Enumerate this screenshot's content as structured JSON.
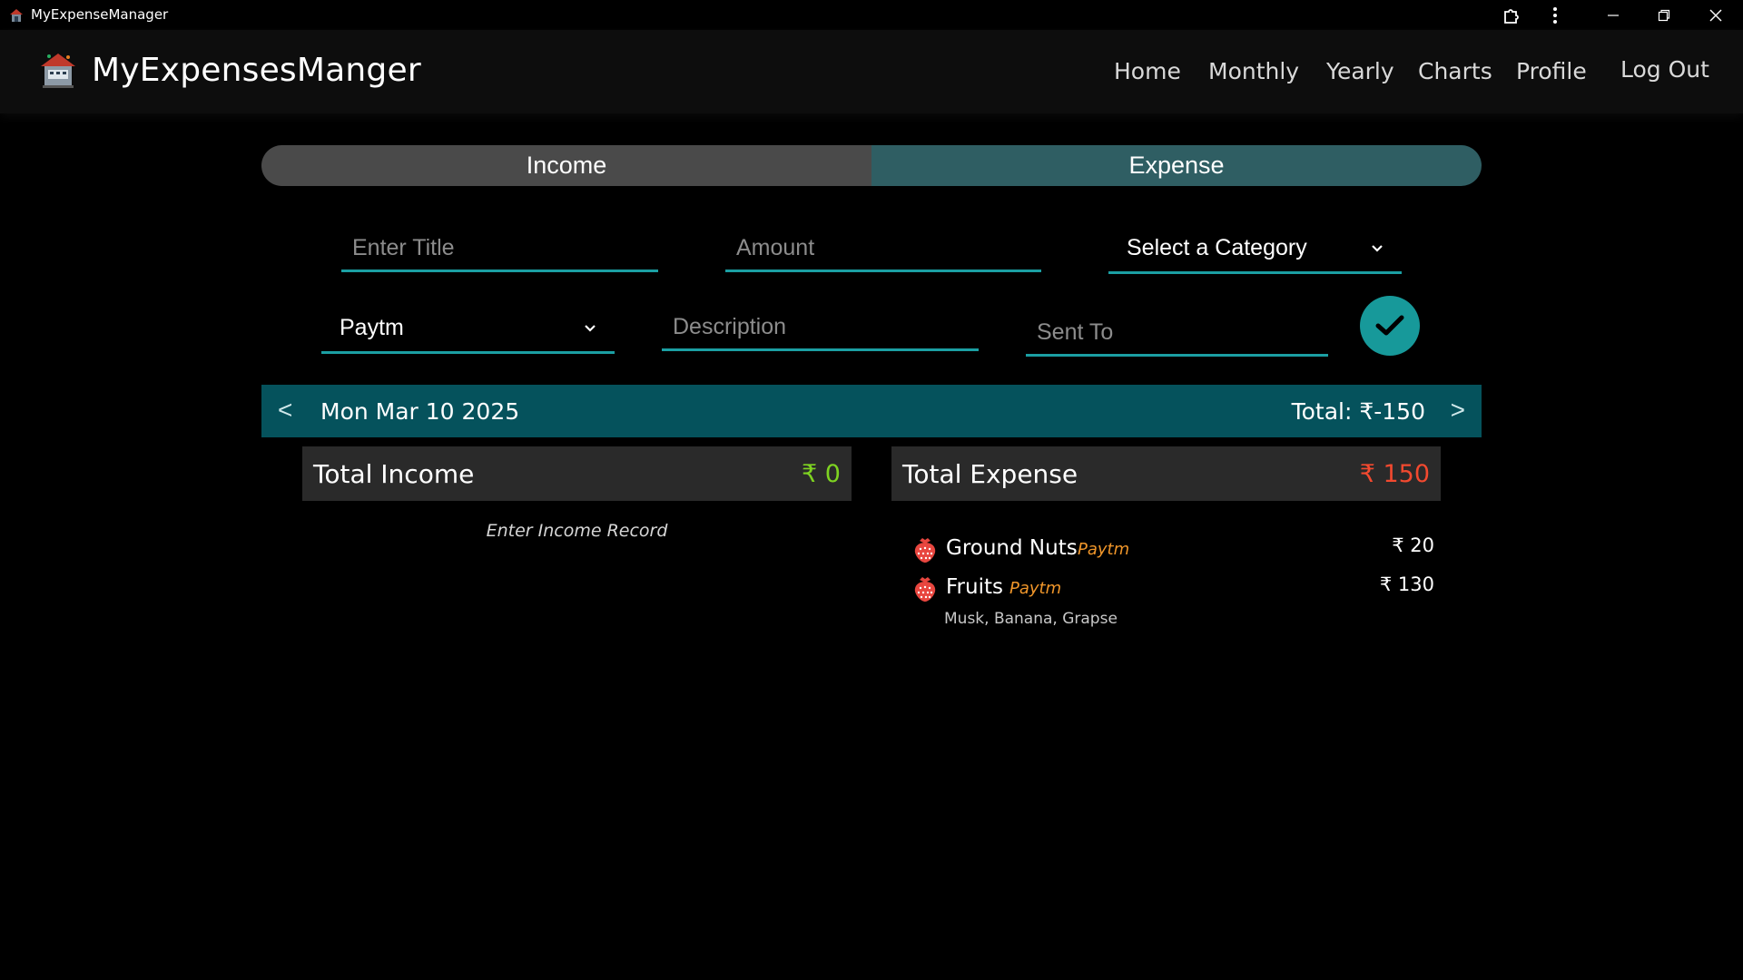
{
  "window": {
    "title": "MyExpenseManager",
    "icon": "app-house-icon"
  },
  "header": {
    "brand": "MyExpensesManger",
    "nav": [
      "Home",
      "Monthly",
      "Yearly",
      "Charts",
      "Profile",
      "Log Out"
    ]
  },
  "toggle": {
    "income_label": "Income",
    "expense_label": "Expense",
    "selected": "Expense"
  },
  "form": {
    "title_placeholder": "Enter Title",
    "amount_placeholder": "Amount",
    "category_select": "Select a Category",
    "payment_method": "Paytm",
    "description_placeholder": "Description",
    "sent_to_placeholder": "Sent To",
    "submit_icon": "check-icon"
  },
  "day": {
    "prev": "<",
    "date": "Mon Mar 10 2025",
    "total": "Total: ₹-150",
    "next": ">"
  },
  "income": {
    "label": "Total Income",
    "amount": "₹ 0",
    "empty_note": "Enter Income Record"
  },
  "expense": {
    "label": "Total Expense",
    "amount": "₹ 150",
    "items": [
      {
        "name": "Ground Nuts",
        "method": "Paytm",
        "amount": "₹ 20",
        "description": "",
        "icon": "strawberry-icon"
      },
      {
        "name": "Fruits",
        "method": "Paytm",
        "amount": "₹ 130",
        "description": "Musk, Banana, Grapse",
        "icon": "strawberry-icon"
      }
    ]
  },
  "colors": {
    "accent": "#1b9fa3",
    "date_bar": "#05525c",
    "income_amount": "#7ed321",
    "expense_amount": "#f2492f",
    "method": "#f0962a"
  }
}
